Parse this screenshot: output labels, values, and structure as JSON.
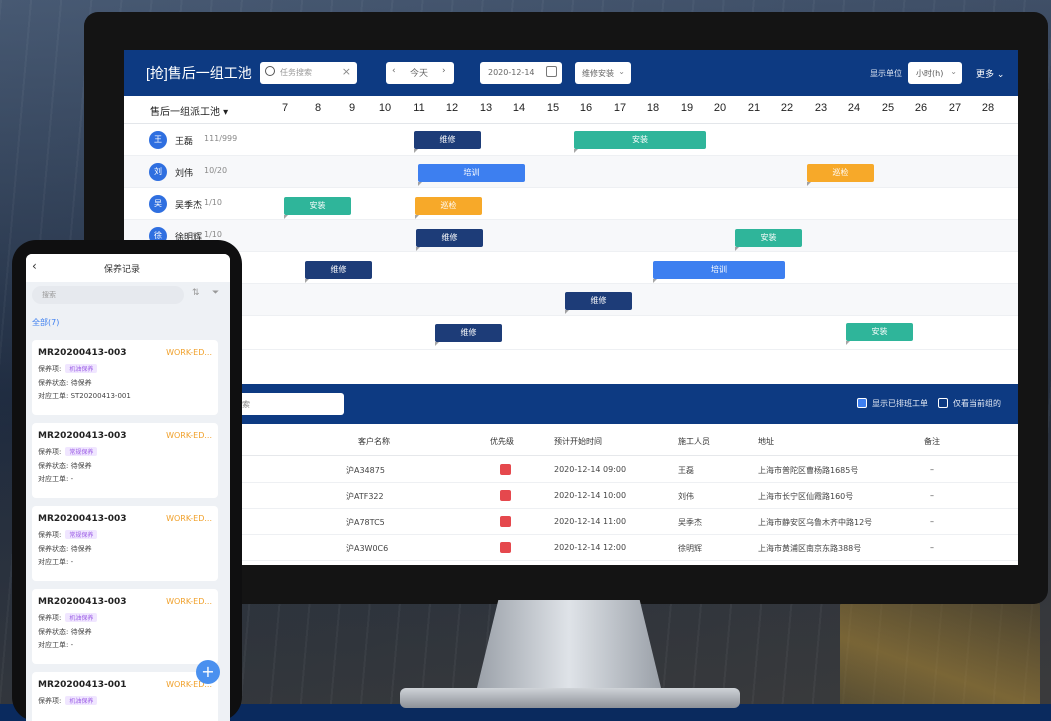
{
  "desktop": {
    "pool_title": "[抢]售后一组工池",
    "search_placeholder": "任务搜索",
    "day_label": "今天",
    "date_value": "2020-12-14",
    "type_select": "维修安装",
    "unit_label": "显示单位",
    "unit_value": "小时(h)",
    "more_label": "更多",
    "group_label": "售后一组派工池",
    "days": [
      "7",
      "8",
      "9",
      "10",
      "11",
      "12",
      "13",
      "14",
      "15",
      "16",
      "17",
      "18",
      "19",
      "20",
      "21",
      "22",
      "23",
      "24",
      "25",
      "26",
      "27",
      "28"
    ],
    "workers": [
      {
        "avatar": "王",
        "name": "王磊",
        "count": "111/999"
      },
      {
        "avatar": "刘",
        "name": "刘伟",
        "count": "10/20"
      },
      {
        "avatar": "吴",
        "name": "吴季杰",
        "count": "1/10"
      },
      {
        "avatar": "徐",
        "name": "徐明辉",
        "count": "1/10"
      }
    ],
    "bars": {
      "r1a": "维修",
      "r1b": "安装",
      "r2a": "培训",
      "r2b": "巡检",
      "r3a": "安装",
      "r3b": "巡检",
      "r4a": "维修",
      "r4b": "安装",
      "r5a": "维修",
      "r5b": "培训",
      "r6a": "维修",
      "r7a": "维修",
      "r7b": "安装"
    },
    "table": {
      "search_placeholder": "搜索",
      "check1": "显示已排班工单",
      "check2": "仅看当前组的",
      "headers": {
        "customer": "客户名称",
        "priority": "优先级",
        "start": "预计开始时间",
        "worker": "施工人员",
        "address": "地址",
        "remark": "备注"
      },
      "rows": [
        {
          "customer": "沪A34875",
          "start": "2020-12-14 09:00",
          "worker": "王磊",
          "address": "上海市普陀区曹杨路1685号",
          "remark": "–"
        },
        {
          "customer": "沪ATF322",
          "start": "2020-12-14 10:00",
          "worker": "刘伟",
          "address": "上海市长宁区仙霞路160号",
          "remark": "–"
        },
        {
          "customer": "沪A78TC5",
          "start": "2020-12-14 11:00",
          "worker": "吴季杰",
          "address": "上海市静安区乌鲁木齐中路12号",
          "remark": "–"
        },
        {
          "customer": "沪A3W0C6",
          "start": "2020-12-14 12:00",
          "worker": "徐明辉",
          "address": "上海市黄浦区南京东路388号",
          "remark": "–"
        }
      ]
    }
  },
  "phone": {
    "back": "‹",
    "title": "保养记录",
    "search_placeholder": "搜索",
    "filter_all": "全部(7)",
    "cards": [
      {
        "id": "MR20200413-003",
        "status": "WORK-ED...",
        "l1": "保养项:",
        "tag": "机油保养",
        "l2": "保养状态: 待保养",
        "l3": "对应工单: ST20200413-001"
      },
      {
        "id": "MR20200413-003",
        "status": "WORK-ED...",
        "l1": "保养项:",
        "tag": "常规保养",
        "l2": "保养状态: 待保养",
        "l3": "对应工单: -"
      },
      {
        "id": "MR20200413-003",
        "status": "WORK-ED...",
        "l1": "保养项:",
        "tag": "常规保养",
        "l2": "保养状态: 待保养",
        "l3": "对应工单: -"
      },
      {
        "id": "MR20200413-003",
        "status": "WORK-ED...",
        "l1": "保养项:",
        "tag": "机油保养",
        "l2": "保养状态: 待保养",
        "l3": "对应工单: -"
      },
      {
        "id": "MR20200413-001",
        "status": "WORK-ED...",
        "l1": "保养项:",
        "tag": "机油保养",
        "l2": "",
        "l3": ""
      }
    ]
  },
  "colors": {
    "brand": "#0d3a82",
    "navy": "#1d3c78",
    "teal": "#2fb59a",
    "blue": "#3d7ff0",
    "orange": "#f7a929",
    "priority": "#e5484d"
  }
}
